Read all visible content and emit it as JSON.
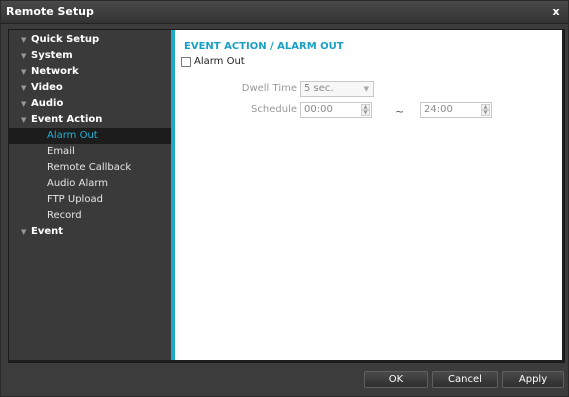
{
  "window": {
    "title": "Remote Setup",
    "close_glyph": "x"
  },
  "sidebar": {
    "groups": [
      {
        "label": "Quick Setup"
      },
      {
        "label": "System"
      },
      {
        "label": "Network"
      },
      {
        "label": "Video"
      },
      {
        "label": "Audio"
      },
      {
        "label": "Event Action"
      },
      {
        "label": "Event"
      }
    ],
    "event_action_items": [
      {
        "label": "Alarm Out",
        "active": true
      },
      {
        "label": "Email"
      },
      {
        "label": "Remote Callback"
      },
      {
        "label": "Audio Alarm"
      },
      {
        "label": "FTP Upload"
      },
      {
        "label": "Record"
      }
    ],
    "expand_glyph": "▼"
  },
  "main": {
    "section_title": "EVENT ACTION / ALARM OUT",
    "alarm_out": {
      "label": "Alarm Out",
      "checked": false
    },
    "dwell_time": {
      "label": "Dwell Time",
      "value": "5 sec."
    },
    "schedule": {
      "label": "Schedule",
      "start": "00:00",
      "separator": "~",
      "end": "24:00"
    }
  },
  "footer": {
    "ok": "OK",
    "cancel": "Cancel",
    "apply": "Apply"
  },
  "colors": {
    "accent": "#1ea8cc",
    "active_text": "#1fb2d6",
    "window_bg": "#3c3c3c"
  }
}
